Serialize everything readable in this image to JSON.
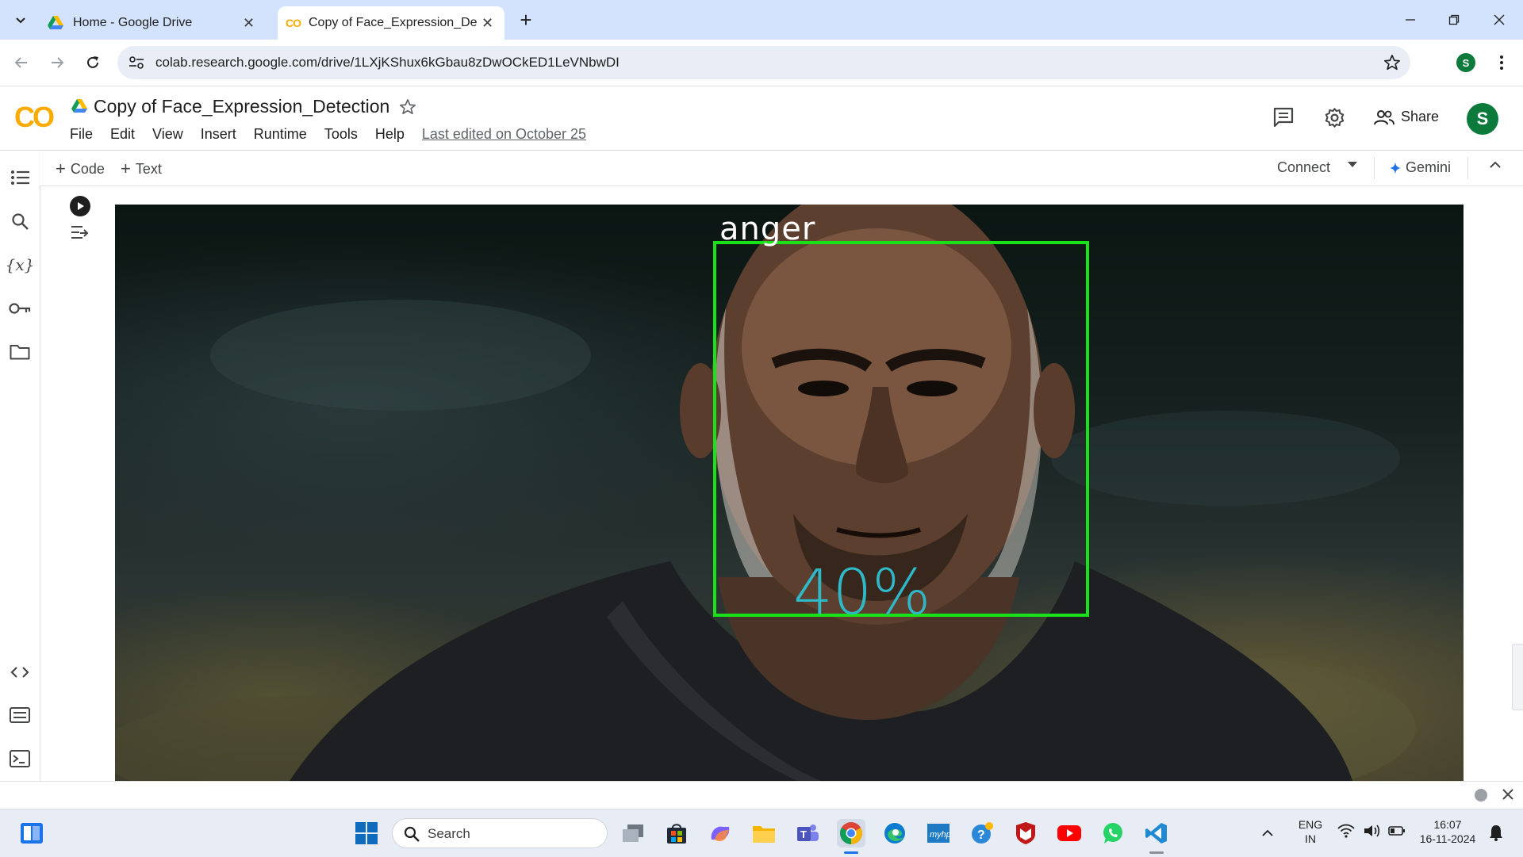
{
  "browser": {
    "tabs": [
      {
        "title": "Home - Google Drive",
        "active": false
      },
      {
        "title": "Copy of Face_Expression_Detect",
        "active": true
      }
    ],
    "new_tab_symbol": "+",
    "url": "colab.research.google.com/drive/1LXjKShux6kGbau8zDwOCkED1LeVNbwDI",
    "profile_initial": "S"
  },
  "colab": {
    "logo_text": "CO",
    "notebook_title": "Copy of Face_Expression_Detection",
    "menu": [
      "File",
      "Edit",
      "View",
      "Insert",
      "Runtime",
      "Tools",
      "Help"
    ],
    "last_edited": "Last edited on October 25",
    "share_label": "Share",
    "avatar_initial": "S",
    "toolbar": {
      "add_code": "Code",
      "add_text": "Text",
      "connect": "Connect",
      "gemini": "Gemini"
    }
  },
  "output": {
    "emotion_label": "anger",
    "confidence": "40%",
    "box_color": "#19e219",
    "confidence_color": "#2fb8c8"
  },
  "taskbar": {
    "search_placeholder": "Search",
    "language_line1": "ENG",
    "language_line2": "IN",
    "time": "16:07",
    "date": "16-11-2024"
  },
  "colors": {
    "tabstrip": "#d3e3fd",
    "colab_orange": "#f9ab00",
    "accent_blue": "#1a73e8"
  }
}
